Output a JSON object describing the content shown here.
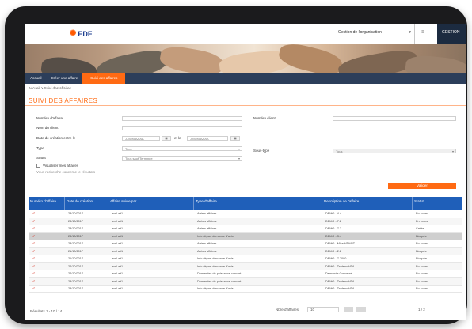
{
  "header": {
    "logo_text": "EDF",
    "user_select": "Gestion de l'organisation",
    "user_short": "GESTION"
  },
  "nav": {
    "items": [
      "Accueil",
      "Créer une affaire",
      "Suivi des affaires"
    ]
  },
  "breadcrumb": "Accueil  >  Suivi des affaires",
  "page_title": "SUIVI DES AFFAIRES",
  "form": {
    "numero_label": "Numéro d'affaire",
    "nom_label": "Nom du client",
    "date_label": "Date de création entre le",
    "date_from_placeholder": "JJ/MM/AAAA",
    "date_between": "et le",
    "date_to_placeholder": "JJ/MM/AAAA",
    "type_label": "Type",
    "type_value": "Tous",
    "statut_label": "Statut",
    "statut_value": "Tous sauf Terminée",
    "numero_client_label": "Numéro client",
    "sous_type_label": "Sous-type",
    "sous_type_value": "Tous",
    "checkbox_label": "Visualiser mes affaires",
    "hint": "Vous recherche concerne le résultats",
    "search_button": "Valider"
  },
  "table": {
    "headers": [
      "Numéro d'affaire",
      "Date de création",
      "Affaire suivie par",
      "Type d'affaire",
      "Description de l'affaire",
      "Statut"
    ],
    "rows": [
      {
        "num": "N°",
        "date": "28/10/2017",
        "suivi": "avril alt1",
        "type": "Autres affaires",
        "desc": "DEMO - 4.4",
        "statut": "En cours"
      },
      {
        "num": "N°",
        "date": "28/10/2017",
        "suivi": "avril alt1",
        "type": "Autres affaires",
        "desc": "DEMO - 7.2",
        "statut": "En cours"
      },
      {
        "num": "N°",
        "date": "28/10/2017",
        "suivi": "avril alt1",
        "type": "Autres affaires",
        "desc": "DEMO - 7.2",
        "statut": "Créée"
      },
      {
        "num": "N°",
        "date": "28/10/2017",
        "suivi": "avril alt1",
        "type": "Info départ demande d'avis",
        "desc": "DEMO - 3.4",
        "statut": "Bloquée"
      },
      {
        "num": "N°",
        "date": "28/10/2017",
        "suivi": "avril alt1",
        "type": "Autres affaires",
        "desc": "DEMO - Mise HTA/BT",
        "statut": "En cours"
      },
      {
        "num": "N°",
        "date": "21/10/2017",
        "suivi": "avril alt1",
        "type": "Autres affaires",
        "desc": "DEMO - 2.2",
        "statut": "Bloquée"
      },
      {
        "num": "N°",
        "date": "21/10/2017",
        "suivi": "avril alt1",
        "type": "Info départ demande d'avis",
        "desc": "DEMO - 7.7000",
        "statut": "Bloquée"
      },
      {
        "num": "N°",
        "date": "22/10/2017",
        "suivi": "avril alt1",
        "type": "Info départ demande d'avis",
        "desc": "DEMO - Tableau HTA",
        "statut": "En cours"
      },
      {
        "num": "N°",
        "date": "22/10/2017",
        "suivi": "avril alt1",
        "type": "Demandes de puissance concert",
        "desc": "Demande Concerné",
        "statut": "En cours"
      },
      {
        "num": "N°",
        "date": "28/10/2017",
        "suivi": "avril alt1",
        "type": "Demandes de puissance concert",
        "desc": "DEMO - Tableau HTA",
        "statut": "En cours"
      },
      {
        "num": "N°",
        "date": "28/10/2017",
        "suivi": "avril alt1",
        "type": "Info départ demande d'avis",
        "desc": "DEMO - Tableau HTA",
        "statut": "En cours"
      }
    ]
  },
  "footer": {
    "results": "Résultats 1 - 10 / 14",
    "per_page_label": "Nbre d'affaires",
    "per_page_value": "10",
    "pagination": "1 / 2"
  }
}
